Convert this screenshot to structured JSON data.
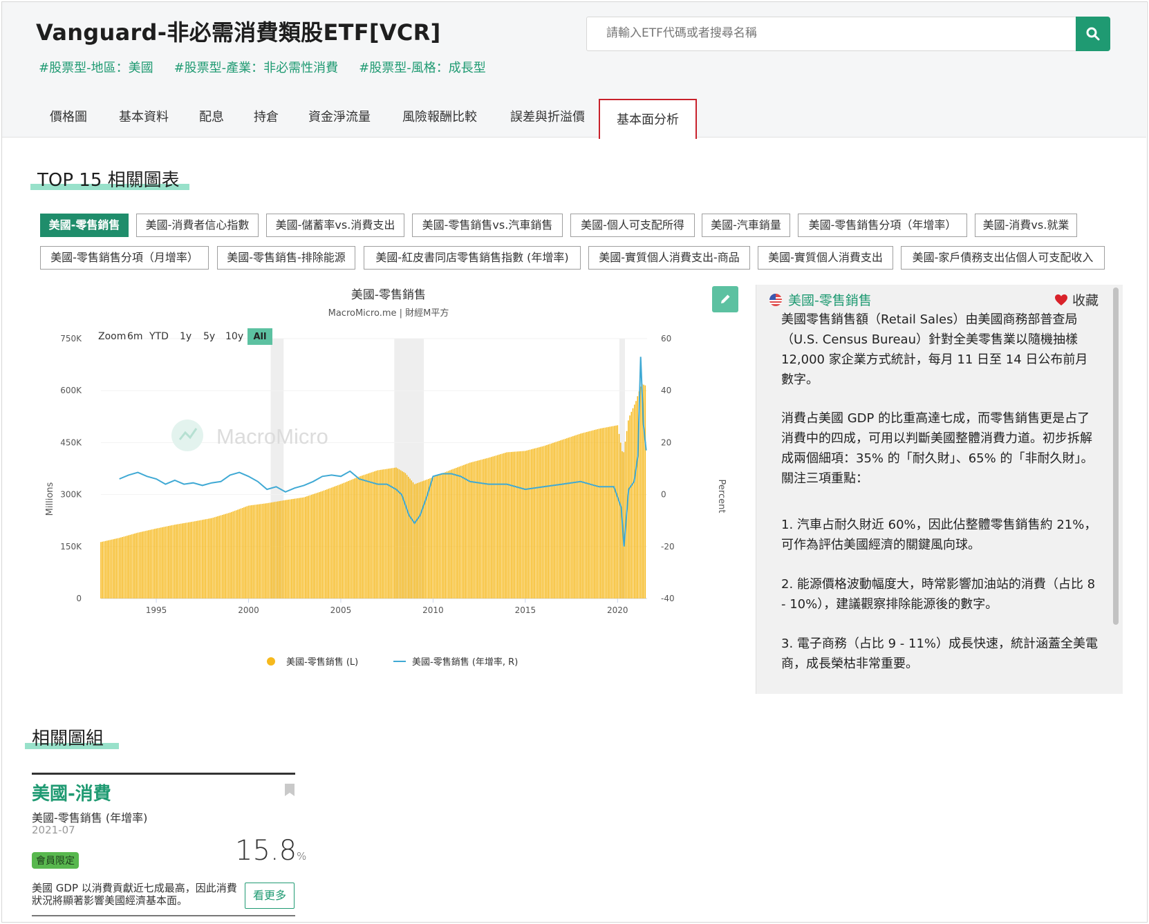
{
  "header": {
    "title": "Vanguard-非必需消費類股ETF[VCR]",
    "tags": [
      "#股票型-地區：美國",
      "#股票型-產業：非必需性消費",
      "#股票型-風格：成長型"
    ],
    "search_placeholder": "請輸入ETF代碼或者搜尋名稱"
  },
  "tabs": [
    "價格圖",
    "基本資料",
    "配息",
    "持倉",
    "資金淨流量",
    "風險報酬比較",
    "誤差與折溢價",
    "基本面分析"
  ],
  "active_tab": "基本面分析",
  "top15": {
    "title": "TOP 15 相關圖表",
    "chips": [
      "美國-零售銷售",
      "美國-消費者信心指數",
      "美國-儲蓄率vs.消費支出",
      "美國-零售銷售vs.汽車銷售",
      "美國-個人可支配所得",
      "美國-汽車銷量",
      "美國-零售銷售分項（年增率）",
      "美國-消費vs.就業",
      "美國-零售銷售分項（月增率）",
      "美國-零售銷售-排除能源",
      "美國-紅皮書同店零售銷售指數 (年增率)",
      "美國-實質個人消費支出-商品",
      "美國-實質個人消費支出",
      "美國-家戶債務支出佔個人可支配收入"
    ],
    "active_chip": "美國-零售銷售"
  },
  "chart": {
    "title": "美國-零售銷售",
    "subtitle": "MacroMicro.me | 財經M平方",
    "zoom_label": "Zoom",
    "zoom_options": [
      "6m",
      "YTD",
      "1y",
      "5y",
      "10y",
      "All"
    ],
    "zoom_active": "All",
    "watermark": "MacroMicro",
    "left_axis_title": "Millions",
    "right_axis_title": "Percent",
    "left_ticks": [
      "750K",
      "600K",
      "450K",
      "300K",
      "150K",
      "0"
    ],
    "right_ticks": [
      "60",
      "40",
      "20",
      "0",
      "-20",
      "-40"
    ],
    "x_ticks": [
      "1995",
      "2000",
      "2005",
      "2010",
      "2015",
      "2020"
    ],
    "legend": [
      "美國-零售銷售 (L)",
      "美國-零售銷售 (年增率, R)"
    ]
  },
  "chart_data": {
    "type": "bar",
    "title": "美國-零售銷售",
    "x_unit": "year",
    "xlim": [
      1992,
      2021.6
    ],
    "ylim_left": [
      0,
      750000
    ],
    "ylim_right": [
      -40,
      60
    ],
    "recessions": [
      [
        2001.2,
        2001.9
      ],
      [
        2007.9,
        2009.5
      ],
      [
        2020.1,
        2020.4
      ]
    ],
    "series": [
      {
        "name": "美國-零售銷售 (L)",
        "type": "bar",
        "axis": "left",
        "color": "#f6b91d",
        "x": [
          1992,
          1993,
          1994,
          1995,
          1996,
          1997,
          1998,
          1999,
          2000,
          2001,
          2002,
          2003,
          2004,
          2005,
          2006,
          2007,
          2008,
          2008.5,
          2009,
          2010,
          2011,
          2012,
          2013,
          2014,
          2015,
          2016,
          2017,
          2018,
          2019,
          2020,
          2020.3,
          2020.6,
          2021,
          2021.3,
          2021.5
        ],
        "values": [
          163000,
          175000,
          190000,
          202000,
          213000,
          222000,
          232000,
          248000,
          268000,
          275000,
          284000,
          292000,
          310000,
          330000,
          352000,
          370000,
          378000,
          362000,
          330000,
          350000,
          372000,
          392000,
          406000,
          422000,
          426000,
          440000,
          458000,
          476000,
          490000,
          500000,
          410000,
          520000,
          570000,
          620000,
          615000
        ]
      },
      {
        "name": "美國-零售銷售 (年增率, R)",
        "type": "line",
        "axis": "right",
        "color": "#3fa9d4",
        "x": [
          1993,
          1993.5,
          1994,
          1994.5,
          1995,
          1995.5,
          1996,
          1996.5,
          1997,
          1997.5,
          1998,
          1998.5,
          1999,
          1999.5,
          2000,
          2000.5,
          2001,
          2001.5,
          2002,
          2002.5,
          2003,
          2003.5,
          2004,
          2004.5,
          2005,
          2005.5,
          2006,
          2006.5,
          2007,
          2007.5,
          2008,
          2008.3,
          2008.7,
          2009,
          2009.3,
          2009.7,
          2010,
          2010.5,
          2011,
          2011.5,
          2012,
          2013,
          2014,
          2015,
          2016,
          2017,
          2018,
          2019,
          2019.8,
          2020.2,
          2020.35,
          2020.6,
          2020.9,
          2021.1,
          2021.25,
          2021.4,
          2021.55
        ],
        "values": [
          6,
          7.5,
          8.5,
          7,
          6,
          4,
          5.5,
          4,
          4.5,
          3.5,
          4.5,
          5,
          7.5,
          8.5,
          7,
          5,
          2,
          3,
          1,
          2.5,
          3.5,
          5,
          7,
          7.5,
          7,
          9,
          6,
          5,
          4,
          4,
          2,
          0,
          -8,
          -11,
          -8,
          0,
          7,
          8,
          8,
          7,
          5,
          4,
          4,
          2,
          3,
          4,
          5,
          3,
          3,
          -5,
          -20,
          2,
          5,
          15,
          53,
          27,
          17
        ]
      }
    ]
  },
  "description": {
    "title": "美國-零售銷售",
    "fav_label": "收藏",
    "paragraphs": [
      "美國零售銷售額（Retail Sales）由美國商務部普查局（U.S. Census Bureau）針對全美零售業以隨機抽樣 12,000 家企業方式統計，每月 11 日至 14 日公布前月數字。",
      "消費占美國 GDP 的比重高達七成，而零售銷售更是占了消費中的四成，可用以判斷美國整體消費力道。初步拆解成兩個細項：35% 的「耐久財」、65% 的「非耐久財」。關注三項重點：",
      "1. 汽車占耐久財近 60%，因此佔整體零售銷售約 21%，可作為評估美國經濟的關鍵風向球。",
      "2. 能源價格波動幅度大，時常影響加油站的消費（占比 8 - 10%），建議觀察排除能源後的數字。",
      "3. 電子商務（占比 9 - 11%）成長快速，統計涵蓋全美電商，成長榮枯非常重要。"
    ]
  },
  "related": {
    "title": "相關圖組",
    "card": {
      "title": "美國-消費",
      "chart_name": "美國-零售銷售 (年增率)",
      "date": "2021-07",
      "badge": "會員限定",
      "value": "15.8",
      "unit": "%",
      "desc": "美國 GDP 以消費貢獻近七成最高，因此消費狀況將顯著影響美國經濟基本面。",
      "more_label": "看更多"
    }
  }
}
